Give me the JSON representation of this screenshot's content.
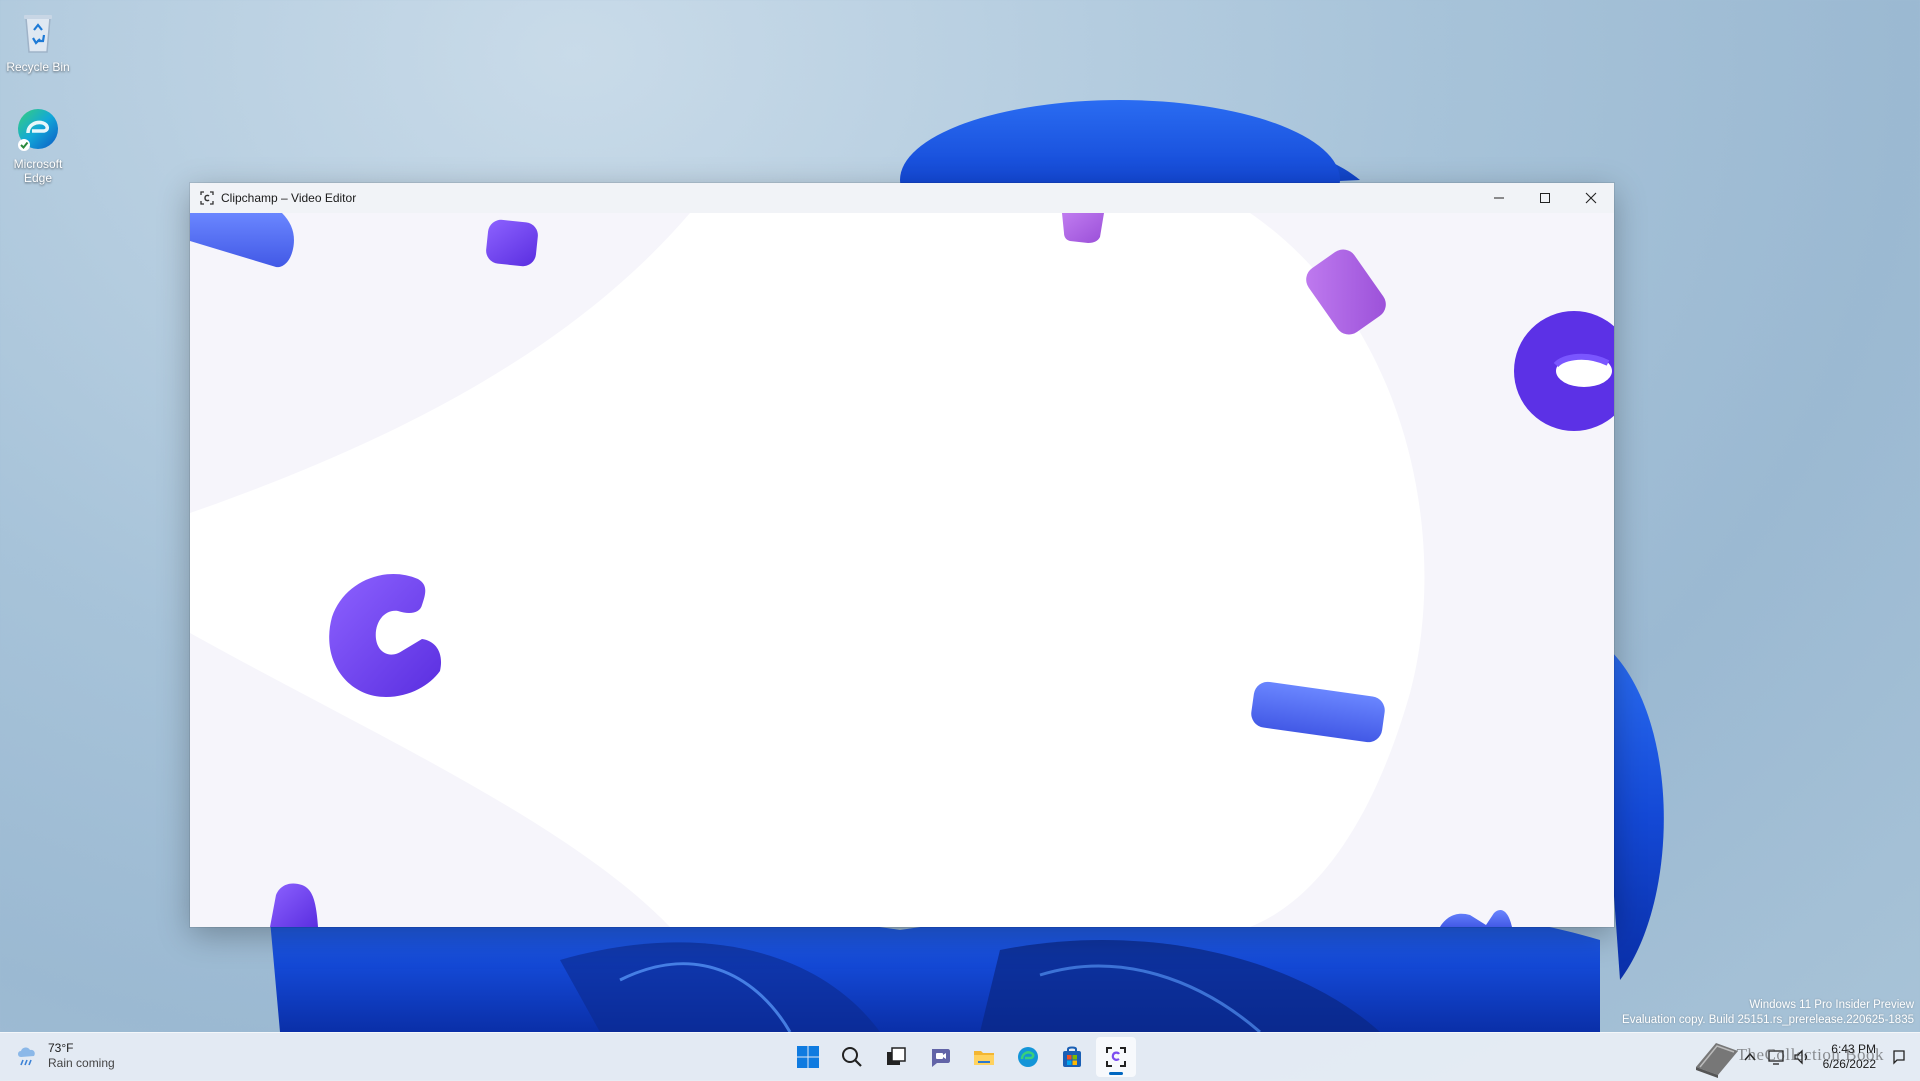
{
  "desktop": {
    "icons": [
      {
        "label": "Recycle Bin",
        "icon": "recycle-bin-icon"
      },
      {
        "label": "Microsoft Edge",
        "icon": "edge-icon"
      }
    ],
    "watermark": {
      "line1": "Windows 11 Pro Insider Preview",
      "line2": "Evaluation copy. Build 25151.rs_prerelease.220625-1835"
    }
  },
  "window": {
    "title": "Clipchamp – Video Editor",
    "controls": {
      "minimize": "minimize-icon",
      "maximize": "maximize-icon",
      "close": "close-icon"
    }
  },
  "taskbar": {
    "weather": {
      "temp": "73°F",
      "condition": "Rain coming"
    },
    "apps": [
      "start-icon",
      "search-icon",
      "task-view-icon",
      "teams-chat-icon",
      "file-explorer-icon",
      "edge-icon",
      "store-icon",
      "clipchamp-icon"
    ],
    "active_app": "clipchamp-icon",
    "tray": {
      "time": "6:43 PM",
      "date": "6/26/2022",
      "overlay_text": "TheCollection Book"
    }
  },
  "colors": {
    "accent": "#0067c0",
    "clipchamp_purple": "#7b4cf0",
    "clipchamp_blue": "#5a73f7",
    "clipchamp_violet": "#b066e0"
  }
}
